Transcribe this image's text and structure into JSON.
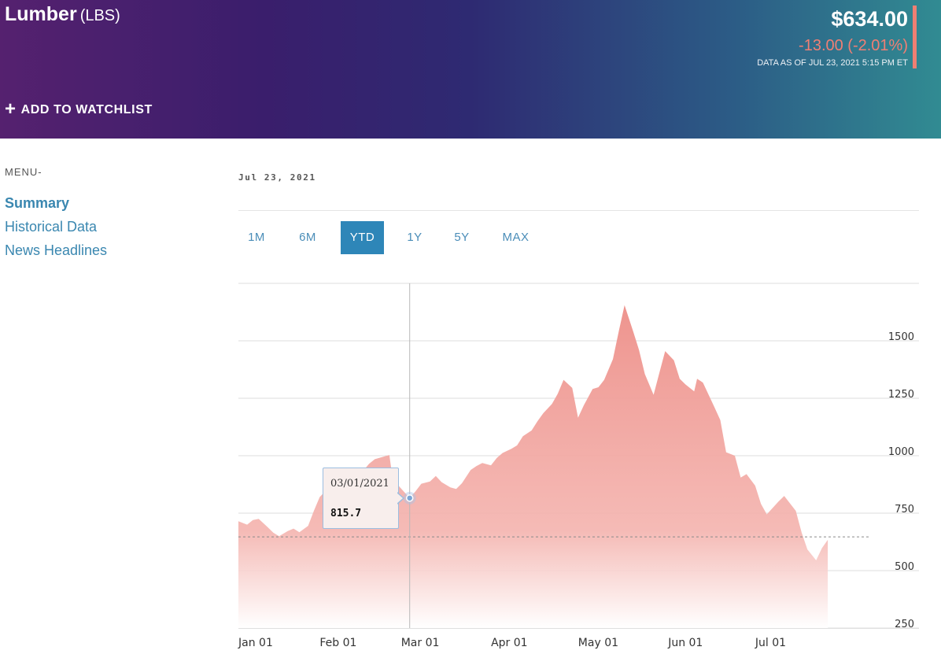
{
  "instrument": {
    "name": "Lumber",
    "unit": "(LBS)",
    "price": "$634.00",
    "change": "-13.00 (-2.01%)",
    "as_of": "DATA AS OF JUL 23, 2021 5:15 PM ET",
    "watchlist_label": "ADD TO WATCHLIST"
  },
  "colors": {
    "accent": "#ef7f73",
    "link": "#3a87b0",
    "tab_active": "#2e86b8",
    "area": "#ef9a94"
  },
  "menu": {
    "label": "MENU-",
    "items": [
      {
        "label": "Summary",
        "active": true
      },
      {
        "label": "Historical Data",
        "active": false
      },
      {
        "label": "News Headlines",
        "active": false
      }
    ]
  },
  "chart_header": {
    "date": "Jul 23, 2021"
  },
  "tabs": [
    {
      "label": "1M",
      "active": false
    },
    {
      "label": "6M",
      "active": false
    },
    {
      "label": "YTD",
      "active": true
    },
    {
      "label": "1Y",
      "active": false
    },
    {
      "label": "5Y",
      "active": false
    },
    {
      "label": "MAX",
      "active": false
    }
  ],
  "tooltip": {
    "date": "03/01/2021",
    "value": "815.7"
  },
  "chart_data": {
    "type": "area",
    "title": "",
    "xlabel": "",
    "ylabel": "",
    "ylim": [
      250,
      1750
    ],
    "y_ticks": [
      250,
      500,
      750,
      1000,
      1250,
      1500
    ],
    "x_ticks": [
      "Jan 01",
      "Feb 01",
      "Mar 01",
      "Apr 01",
      "May 01",
      "Jun 01",
      "Jul 01"
    ],
    "grid": true,
    "reference_line": 647,
    "highlight": {
      "date": "2021-03-01",
      "value": 815.7
    },
    "series": [
      {
        "points": [
          [
            "2021-01-01",
            715
          ],
          [
            "2021-01-04",
            700
          ],
          [
            "2021-01-06",
            720
          ],
          [
            "2021-01-08",
            725
          ],
          [
            "2021-01-11",
            690
          ],
          [
            "2021-01-13",
            665
          ],
          [
            "2021-01-15",
            650
          ],
          [
            "2021-01-18",
            672
          ],
          [
            "2021-01-20",
            683
          ],
          [
            "2021-01-22",
            667
          ],
          [
            "2021-01-25",
            695
          ],
          [
            "2021-01-27",
            760
          ],
          [
            "2021-01-29",
            820
          ],
          [
            "2021-02-01",
            860
          ],
          [
            "2021-02-03",
            880
          ],
          [
            "2021-02-05",
            905
          ],
          [
            "2021-02-08",
            895
          ],
          [
            "2021-02-10",
            935
          ],
          [
            "2021-02-12",
            920
          ],
          [
            "2021-02-15",
            965
          ],
          [
            "2021-02-17",
            985
          ],
          [
            "2021-02-19",
            992
          ],
          [
            "2021-02-22",
            1003
          ],
          [
            "2021-02-23",
            910
          ],
          [
            "2021-02-25",
            872
          ],
          [
            "2021-03-01",
            815.7
          ],
          [
            "2021-03-03",
            845
          ],
          [
            "2021-03-05",
            878
          ],
          [
            "2021-03-08",
            888
          ],
          [
            "2021-03-10",
            912
          ],
          [
            "2021-03-12",
            885
          ],
          [
            "2021-03-15",
            862
          ],
          [
            "2021-03-17",
            855
          ],
          [
            "2021-03-19",
            880
          ],
          [
            "2021-03-22",
            938
          ],
          [
            "2021-03-24",
            955
          ],
          [
            "2021-03-26",
            968
          ],
          [
            "2021-03-29",
            958
          ],
          [
            "2021-03-31",
            990
          ],
          [
            "2021-04-02",
            1012
          ],
          [
            "2021-04-05",
            1030
          ],
          [
            "2021-04-07",
            1045
          ],
          [
            "2021-04-09",
            1085
          ],
          [
            "2021-04-12",
            1110
          ],
          [
            "2021-04-14",
            1150
          ],
          [
            "2021-04-16",
            1185
          ],
          [
            "2021-04-19",
            1225
          ],
          [
            "2021-04-21",
            1270
          ],
          [
            "2021-04-23",
            1330
          ],
          [
            "2021-04-26",
            1295
          ],
          [
            "2021-04-28",
            1165
          ],
          [
            "2021-04-30",
            1220
          ],
          [
            "2021-05-03",
            1290
          ],
          [
            "2021-05-05",
            1298
          ],
          [
            "2021-05-07",
            1330
          ],
          [
            "2021-05-10",
            1420
          ],
          [
            "2021-05-12",
            1540
          ],
          [
            "2021-05-14",
            1655
          ],
          [
            "2021-05-17",
            1540
          ],
          [
            "2021-05-19",
            1460
          ],
          [
            "2021-05-21",
            1355
          ],
          [
            "2021-05-24",
            1265
          ],
          [
            "2021-05-26",
            1360
          ],
          [
            "2021-05-28",
            1455
          ],
          [
            "2021-05-31",
            1415
          ],
          [
            "2021-06-02",
            1335
          ],
          [
            "2021-06-04",
            1310
          ],
          [
            "2021-06-07",
            1280
          ],
          [
            "2021-06-08",
            1335
          ],
          [
            "2021-06-10",
            1318
          ],
          [
            "2021-06-14",
            1210
          ],
          [
            "2021-06-16",
            1155
          ],
          [
            "2021-06-18",
            1015
          ],
          [
            "2021-06-21",
            1000
          ],
          [
            "2021-06-23",
            905
          ],
          [
            "2021-06-25",
            920
          ],
          [
            "2021-06-28",
            870
          ],
          [
            "2021-06-30",
            790
          ],
          [
            "2021-07-02",
            745
          ],
          [
            "2021-07-06",
            800
          ],
          [
            "2021-07-08",
            825
          ],
          [
            "2021-07-12",
            760
          ],
          [
            "2021-07-14",
            665
          ],
          [
            "2021-07-16",
            592
          ],
          [
            "2021-07-19",
            545
          ],
          [
            "2021-07-21",
            598
          ],
          [
            "2021-07-23",
            634
          ]
        ]
      }
    ]
  }
}
